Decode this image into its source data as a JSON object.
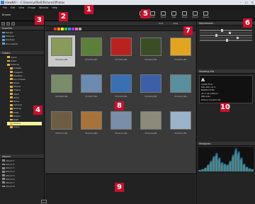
{
  "window": {
    "title": "ViewNX-i - C:\\Users\\u00a0\\Pictures\\Photos",
    "controls": [
      "–",
      "☐",
      "✕"
    ]
  },
  "menu": [
    "File",
    "Edit",
    "View",
    "Image",
    "Window",
    "Help"
  ],
  "toolbar": {
    "left_label": "Browse",
    "right_items": [
      "Edit",
      "Print",
      "Movie",
      "Web",
      "Share",
      "Export",
      "Upload"
    ]
  },
  "markers": [
    "1",
    "2",
    "3",
    "4",
    "5",
    "6",
    "7",
    "8",
    "9",
    "10"
  ],
  "left_panel": {
    "header": "Favorites",
    "favorites": [
      "Recent",
      "Pictures",
      "Desktop",
      "Documents"
    ],
    "tree_header": "Folders",
    "folders": [
      "Users",
      "Public",
      "Pictures",
      "Images",
      "Images2",
      "Desktop",
      "Documents",
      "Music",
      "Photos",
      "Videos",
      "2015",
      "2016",
      "Nikon",
      "Camera",
      "Backup",
      "Edits",
      "Export",
      "RAW",
      "Photos",
      "Scans"
    ],
    "selected_folder": "Photos",
    "lower_header": "Albums",
    "lower_items": [
      "Album 1",
      "Album 2",
      "Album 3",
      "Album 4",
      "Album 5",
      "Album 6",
      "Album 7",
      "Album 8"
    ]
  },
  "center": {
    "filter_label": "Sort",
    "view_label": "View",
    "thumbnails": [
      {
        "name": "Photo01.JPG",
        "color": "#8a9a5b"
      },
      {
        "name": "Photo02.JPG",
        "color": "#5c7f3a"
      },
      {
        "name": "Photo03.JPG",
        "color": "#b8231f"
      },
      {
        "name": "Photo04.JPG",
        "color": "#3b4d24"
      },
      {
        "name": "Photo05.JPG",
        "color": "#e3a51f"
      },
      {
        "name": "Photo06.JPG",
        "color": "#7a8c6a"
      },
      {
        "name": "Photo07.JPG",
        "color": "#6d8bb0"
      },
      {
        "name": "Photo08.JPG",
        "color": "#3a6fb4"
      },
      {
        "name": "Photo09.JPG",
        "color": "#3c5fa8"
      },
      {
        "name": "Photo10.JPG",
        "color": "#5a8f9d"
      },
      {
        "name": "Photo11.JPG",
        "color": "#6e5c44"
      },
      {
        "name": "Photo12.JPG",
        "color": "#a8733a"
      },
      {
        "name": "Photo13.JPG",
        "color": "#7a8da8"
      },
      {
        "name": "Photo14.JPG",
        "color": "#8c8a7a"
      },
      {
        "name": "Photo15.JPG",
        "color": "#9ab3c9"
      }
    ]
  },
  "right_panel": {
    "header": "Adjustments",
    "info_header": "Shooting Info",
    "info_mode": "A",
    "info_lines": [
      "1/200  F5.6",
      "ISO 200  +0.3",
      "NIKON D750",
      "AF-S 24-120mm",
      "WB Auto",
      "Picture Control SD"
    ],
    "histogram_header": "Histogram",
    "histogram_values": [
      2,
      3,
      5,
      9,
      14,
      20,
      24,
      18,
      12,
      10,
      9,
      14,
      22,
      30,
      26,
      18,
      10,
      6,
      4,
      3
    ]
  }
}
